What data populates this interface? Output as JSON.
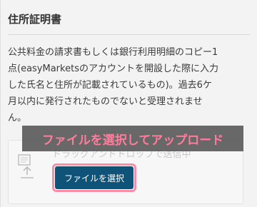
{
  "section": {
    "title": "住所証明書",
    "description_lines": [
      "公共料金の請求書もしくは銀行利用明細のコピー1",
      "点(easyMarketsのアカウントを開設した際に入力",
      "した氏名と住所が記載されているもの)。過去6ケ",
      "月以内に発行されたものでないと受理されませ",
      "ん。"
    ]
  },
  "upload": {
    "drop_hint": "ドラッグアンドドロップで送信中",
    "select_button_label": "ファイルを選択"
  },
  "annotation": {
    "banner_text": "ファイルを選択してアップロード",
    "banner_text_color": "#ff7c9c",
    "highlight_color": "#ff8aa7"
  },
  "colors": {
    "button_bg": "#0f5378",
    "panel_bg": "#f3f3f3"
  },
  "icons": {
    "upload": "document-upload-icon"
  }
}
